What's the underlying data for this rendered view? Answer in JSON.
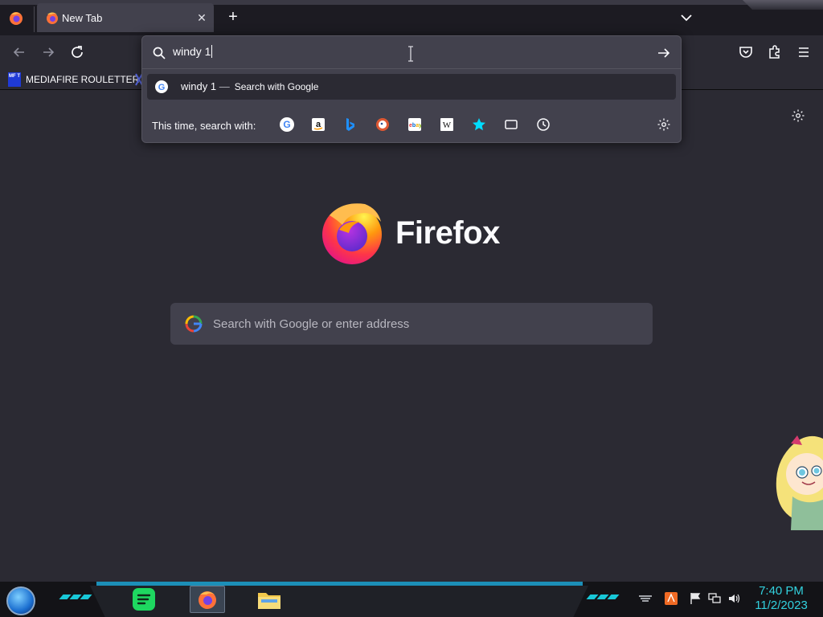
{
  "window": {
    "tab_title": "New Tab",
    "close_tab_icon": "close-icon",
    "new_tab_icon": "plus-icon",
    "list_tabs_icon": "chevron-down-icon"
  },
  "toolbar": {
    "back_icon": "arrow-left-icon",
    "forward_icon": "arrow-right-icon",
    "reload_icon": "reload-icon",
    "pocket_icon": "pocket-icon",
    "extensions_icon": "puzzle-icon",
    "menu_icon": "hamburger-icon"
  },
  "bookmarks": {
    "items": [
      {
        "icon_text": "MF T",
        "label": "MEDIAFIRE ROULETTER"
      }
    ]
  },
  "urlbar": {
    "value": "windy 1",
    "go_icon": "arrow-right-icon",
    "suggestion": {
      "query": "windy 1",
      "separator": "—",
      "action": "Search with Google"
    },
    "oneoff_label": "This time, search with:",
    "engines": [
      "google",
      "amazon",
      "bing",
      "duckduckgo",
      "ebay",
      "wikipedia",
      "bookmarks",
      "tabs",
      "history"
    ],
    "settings_icon": "gear-icon"
  },
  "newtab": {
    "brand": "Firefox",
    "search_placeholder": "Search with Google or enter address",
    "settings_icon": "gear-icon"
  },
  "taskbar": {
    "apps": [
      "spotify",
      "firefox",
      "file-explorer"
    ],
    "clock_time": "7:40 PM",
    "clock_date": "11/2/2023"
  },
  "colors": {
    "page_bg": "#2b2a33",
    "panel_bg": "#42414d",
    "clock": "#32d1de",
    "accent_stripe": "#1c8fb8"
  }
}
